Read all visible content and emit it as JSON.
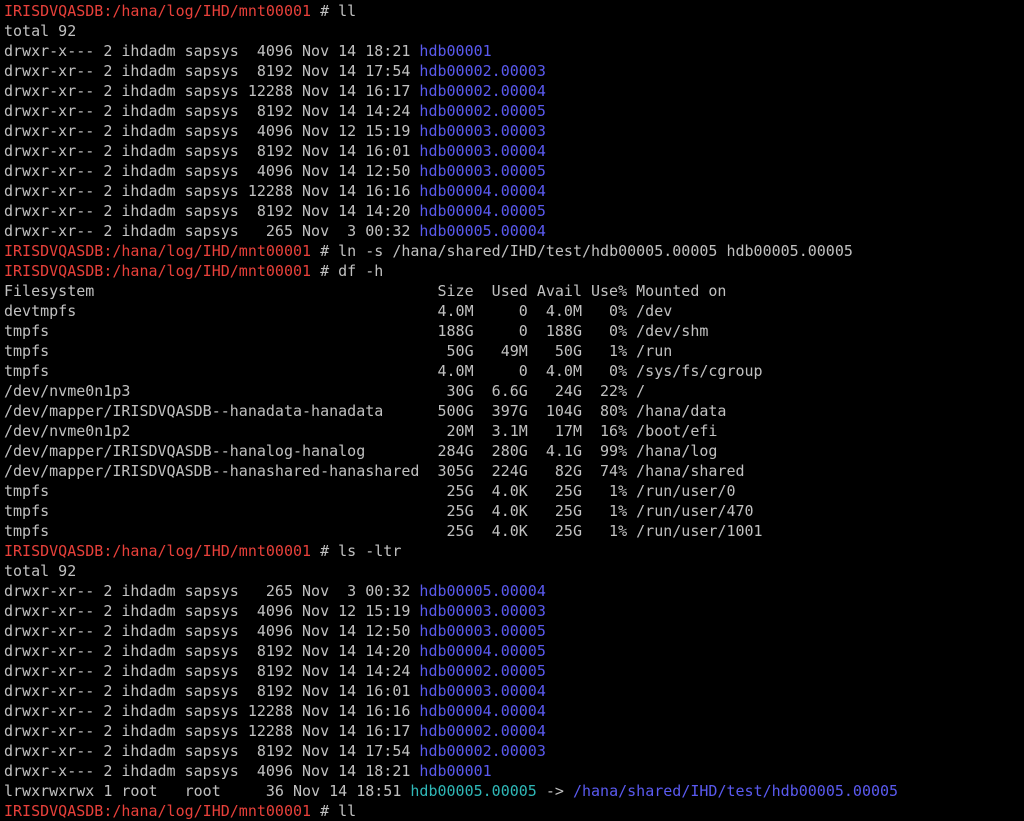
{
  "terminal": {
    "lines": [
      {
        "kind": "cmd",
        "prompt": "IRISDVQASDB:/hana/log/IHD/mnt00001",
        "sep": " # ",
        "cmd": "ll"
      },
      {
        "kind": "text",
        "text": "total 92"
      },
      {
        "kind": "dir",
        "meta": "drwxr-x--- 2 ihdadm sapsys  4096 Nov 14 18:21 ",
        "name": "hdb00001"
      },
      {
        "kind": "dir",
        "meta": "drwxr-xr-- 2 ihdadm sapsys  8192 Nov 14 17:54 ",
        "name": "hdb00002.00003"
      },
      {
        "kind": "dir",
        "meta": "drwxr-xr-- 2 ihdadm sapsys 12288 Nov 14 16:17 ",
        "name": "hdb00002.00004"
      },
      {
        "kind": "dir",
        "meta": "drwxr-xr-- 2 ihdadm sapsys  8192 Nov 14 14:24 ",
        "name": "hdb00002.00005"
      },
      {
        "kind": "dir",
        "meta": "drwxr-xr-- 2 ihdadm sapsys  4096 Nov 12 15:19 ",
        "name": "hdb00003.00003"
      },
      {
        "kind": "dir",
        "meta": "drwxr-xr-- 2 ihdadm sapsys  8192 Nov 14 16:01 ",
        "name": "hdb00003.00004"
      },
      {
        "kind": "dir",
        "meta": "drwxr-xr-- 2 ihdadm sapsys  4096 Nov 14 12:50 ",
        "name": "hdb00003.00005"
      },
      {
        "kind": "dir",
        "meta": "drwxr-xr-- 2 ihdadm sapsys 12288 Nov 14 16:16 ",
        "name": "hdb00004.00004"
      },
      {
        "kind": "dir",
        "meta": "drwxr-xr-- 2 ihdadm sapsys  8192 Nov 14 14:20 ",
        "name": "hdb00004.00005"
      },
      {
        "kind": "dir",
        "meta": "drwxr-xr-- 2 ihdadm sapsys   265 Nov  3 00:32 ",
        "name": "hdb00005.00004"
      },
      {
        "kind": "cmd",
        "prompt": "IRISDVQASDB:/hana/log/IHD/mnt00001",
        "sep": " # ",
        "cmd": "ln -s /hana/shared/IHD/test/hdb00005.00005 hdb00005.00005"
      },
      {
        "kind": "cmd",
        "prompt": "IRISDVQASDB:/hana/log/IHD/mnt00001",
        "sep": " # ",
        "cmd": "df -h"
      },
      {
        "kind": "text",
        "text": "Filesystem                                      Size  Used Avail Use% Mounted on"
      },
      {
        "kind": "text",
        "text": "devtmpfs                                        4.0M     0  4.0M   0% /dev"
      },
      {
        "kind": "text",
        "text": "tmpfs                                           188G     0  188G   0% /dev/shm"
      },
      {
        "kind": "text",
        "text": "tmpfs                                            50G   49M   50G   1% /run"
      },
      {
        "kind": "text",
        "text": "tmpfs                                           4.0M     0  4.0M   0% /sys/fs/cgroup"
      },
      {
        "kind": "text",
        "text": "/dev/nvme0n1p3                                   30G  6.6G   24G  22% /"
      },
      {
        "kind": "text",
        "text": "/dev/mapper/IRISDVQASDB--hanadata-hanadata      500G  397G  104G  80% /hana/data"
      },
      {
        "kind": "text",
        "text": "/dev/nvme0n1p2                                   20M  3.1M   17M  16% /boot/efi"
      },
      {
        "kind": "text",
        "text": "/dev/mapper/IRISDVQASDB--hanalog-hanalog        284G  280G  4.1G  99% /hana/log"
      },
      {
        "kind": "text",
        "text": "/dev/mapper/IRISDVQASDB--hanashared-hanashared  305G  224G   82G  74% /hana/shared"
      },
      {
        "kind": "text",
        "text": "tmpfs                                            25G  4.0K   25G   1% /run/user/0"
      },
      {
        "kind": "text",
        "text": "tmpfs                                            25G  4.0K   25G   1% /run/user/470"
      },
      {
        "kind": "text",
        "text": "tmpfs                                            25G  4.0K   25G   1% /run/user/1001"
      },
      {
        "kind": "cmd",
        "prompt": "IRISDVQASDB:/hana/log/IHD/mnt00001",
        "sep": " # ",
        "cmd": "ls -ltr"
      },
      {
        "kind": "text",
        "text": "total 92"
      },
      {
        "kind": "dir",
        "meta": "drwxr-xr-- 2 ihdadm sapsys   265 Nov  3 00:32 ",
        "name": "hdb00005.00004"
      },
      {
        "kind": "dir",
        "meta": "drwxr-xr-- 2 ihdadm sapsys  4096 Nov 12 15:19 ",
        "name": "hdb00003.00003"
      },
      {
        "kind": "dir",
        "meta": "drwxr-xr-- 2 ihdadm sapsys  4096 Nov 14 12:50 ",
        "name": "hdb00003.00005"
      },
      {
        "kind": "dir",
        "meta": "drwxr-xr-- 2 ihdadm sapsys  8192 Nov 14 14:20 ",
        "name": "hdb00004.00005"
      },
      {
        "kind": "dir",
        "meta": "drwxr-xr-- 2 ihdadm sapsys  8192 Nov 14 14:24 ",
        "name": "hdb00002.00005"
      },
      {
        "kind": "dir",
        "meta": "drwxr-xr-- 2 ihdadm sapsys  8192 Nov 14 16:01 ",
        "name": "hdb00003.00004"
      },
      {
        "kind": "dir",
        "meta": "drwxr-xr-- 2 ihdadm sapsys 12288 Nov 14 16:16 ",
        "name": "hdb00004.00004"
      },
      {
        "kind": "dir",
        "meta": "drwxr-xr-- 2 ihdadm sapsys 12288 Nov 14 16:17 ",
        "name": "hdb00002.00004"
      },
      {
        "kind": "dir",
        "meta": "drwxr-xr-- 2 ihdadm sapsys  8192 Nov 14 17:54 ",
        "name": "hdb00002.00003"
      },
      {
        "kind": "dir",
        "meta": "drwxr-x--- 2 ihdadm sapsys  4096 Nov 14 18:21 ",
        "name": "hdb00001"
      },
      {
        "kind": "link",
        "meta": "lrwxrwxrwx 1 root   root     36 Nov 14 18:51 ",
        "name": "hdb00005.00005",
        "arrow": " -> ",
        "target": "/hana/shared/IHD/test/hdb00005.00005"
      },
      {
        "kind": "cmd",
        "prompt": "IRISDVQASDB:/hana/log/IHD/mnt00001",
        "sep": " # ",
        "cmd": "ll"
      }
    ]
  },
  "colors": {
    "background": "#000000",
    "text": "#c0c0c0",
    "prompt": "#e8403a",
    "directory": "#5a5af0",
    "symlink": "#2fb8b8"
  }
}
